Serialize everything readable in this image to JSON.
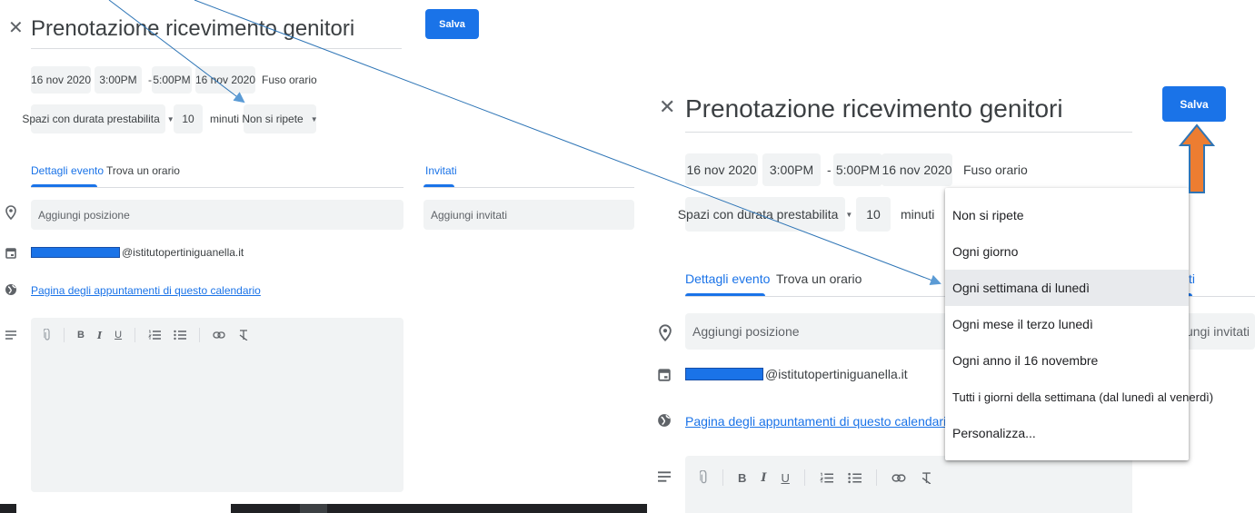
{
  "event": {
    "title": "Prenotazione ricevimento genitori",
    "save_label": "Salva",
    "start_date": "16 nov 2020",
    "start_time": "3:00PM",
    "time_sep": "-",
    "end_time": "5:00PM",
    "end_date": "16 nov 2020",
    "timezone_label": "Fuso orario",
    "slot_type": "Spazi con durata prestabilita",
    "slot_duration": "10",
    "slot_unit": "minuti",
    "repeat": "Non si ripete",
    "tabs": [
      "Dettagli evento",
      "Trova un orario"
    ],
    "guests_tab": "Invitati",
    "location_placeholder": "Aggiungi posizione",
    "guests_placeholder": "Aggiungi invitati",
    "calendar_email": "@istitutopertiniguanella.it",
    "appointment_link": "Pagina degli appuntamenti di questo calendario",
    "partial_guests_tab": "ti",
    "partial_guests_placeholder": "ungi invitati"
  },
  "repeat_options": [
    "Non si ripete",
    "Ogni giorno",
    "Ogni settimana di lunedì",
    "Ogni mese il terzo lunedì",
    "Ogni anno il 16 novembre",
    "Tutti i giorni della settimana (dal lunedì al venerdì)",
    "Personalizza..."
  ],
  "selected_repeat_option_index": 2,
  "toolbar_icons": [
    "attachment-icon",
    "bold-icon",
    "italic-icon",
    "underline-icon",
    "numbered-list-icon",
    "bulleted-list-icon",
    "link-icon",
    "clear-formatting-icon"
  ],
  "colors": {
    "accent": "#1a73e8",
    "field_bg": "#f1f3f4",
    "arrow_annotation": "#2e75b6",
    "up_arrow": "#ed7d31"
  }
}
